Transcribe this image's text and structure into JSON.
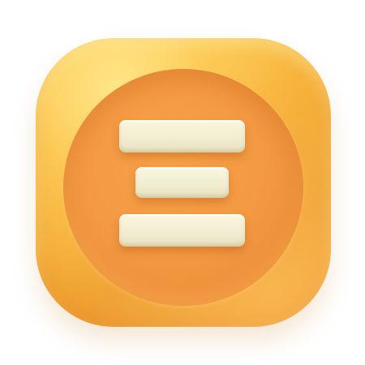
{
  "icon": {
    "name": "menu-lines-icon",
    "colors": {
      "tile_light": "#ffd765",
      "tile_dark": "#f0a132",
      "disc": "#f39a42",
      "bars": "#f2edd3"
    },
    "bar_count": 3
  }
}
